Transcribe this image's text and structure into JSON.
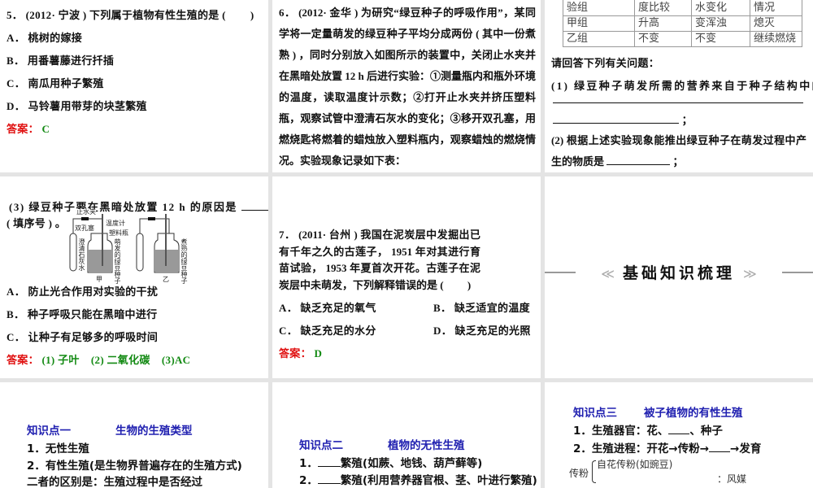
{
  "q5": {
    "stem": "5． (2012· 宁波 ) 下列属于植物有性生殖的是 (　　 )",
    "options": [
      "A． 桃树的嫁接",
      "B． 用番薯藤进行扦插",
      "C． 南瓜用种子繁殖",
      "D． 马铃薯用带芽的块茎繁殖"
    ],
    "answer_label": "答案：",
    "answer": "C"
  },
  "q6": {
    "stem": "6． (2012· 金华 ) 为研究“绿豆种子的呼吸作用”，某同学将一定量萌发的绿豆种子平均分成两份 ( 其中一份煮熟 ) ，同时分别放入如图所示的装置中，关闭止水夹并在黑暗处放置 12 h 后进行实验：①测量瓶内和瓶外环境的温度，读取温度计示数；②打开止水夹并挤压塑料瓶，观察试管中澄清石灰水的变化；③移开双孔塞，用燃烧匙将燃着的蜡烛放入塑料瓶内，观察蜡烛的燃烧情况。实验现象记录如下表："
  },
  "table": {
    "header": [
      "实验现象 实验组",
      "与瓶外温度比较",
      "澄清石灰水变化",
      "蜡烛燃烧情况"
    ],
    "rows": [
      [
        "甲组",
        "升高",
        "变浑浊",
        "熄灭"
      ],
      [
        "乙组",
        "不变",
        "不变",
        "继续燃烧"
      ]
    ]
  },
  "q6_questions": {
    "intro": "请回答下列有关问题：",
    "q1": "(1) 绿豆种子萌发所需的营养来自于种子结构中的",
    "q1_end": "；",
    "q2": "(2) 根据上述实验现象能推出绿豆种子在萌发过程中产生的物质是",
    "q2_end": "；",
    "q3": "(3) 绿豆种子要在黑暗处放置 12 h 的原因是",
    "q3_end": "( 填序号 ) 。"
  },
  "figure": {
    "labels": [
      "止水夹",
      "温度计",
      "双孔塞",
      "塑料瓶",
      "澄清石灰水",
      "萌发的绿豆种子",
      "煮熟的绿豆种子",
      "甲",
      "乙"
    ]
  },
  "q6_options": [
    "A． 防止光合作用对实验的干扰",
    "B． 种子呼吸只能在黑暗中进行",
    "C． 让种子有足够多的呼吸时间"
  ],
  "q6_answer": {
    "label": "答案：",
    "parts": [
      "(1) 子叶",
      "(2) 二氧化碳",
      "(3)AC"
    ]
  },
  "q7": {
    "stem": "7． (2011· 台州 ) 我国在泥炭层中发掘出已有千年之久的古莲子， 1951 年对其进行育苗试验， 1953 年夏首次开花。古莲子在泥炭层中未萌发，下列解释错误的是 (　　 )",
    "options": [
      "A． 缺乏充足的氧气",
      "B． 缺乏适宜的温度",
      "C． 缺乏充足的水分",
      "D． 缺乏充足的光照"
    ],
    "answer_label": "答案：",
    "answer": "D"
  },
  "section": {
    "title": "基础知识梳理",
    "left": "≪",
    "right": "≫"
  },
  "k1": {
    "label": "知识点一",
    "title": "生物的生殖类型",
    "lines": [
      "1．无性生殖",
      "2．有性生殖(是生物界普遍存在的生殖方式)",
      "二者的区别是：生殖过程中是否经过"
    ]
  },
  "k2": {
    "label": "知识点二",
    "title": "植物的无性生殖",
    "l1_pre": "1．",
    "l1_post": "繁殖(如蕨、地钱、葫芦藓等)",
    "l2_pre": "2．",
    "l2_post": "繁殖(利用营养器官根、茎、叶进行繁殖)"
  },
  "k3": {
    "label": "知识点三",
    "title": "被子植物的有性生殖",
    "l1_pre": "1．生殖器官：花、",
    "l1_post": "、种子",
    "l2_pre": "2．生殖进程：开花→传粉→",
    "l2_post": "→发育",
    "self": "自花传粉(如豌豆)",
    "pollination": "传粉",
    "cross": "：风媒"
  }
}
